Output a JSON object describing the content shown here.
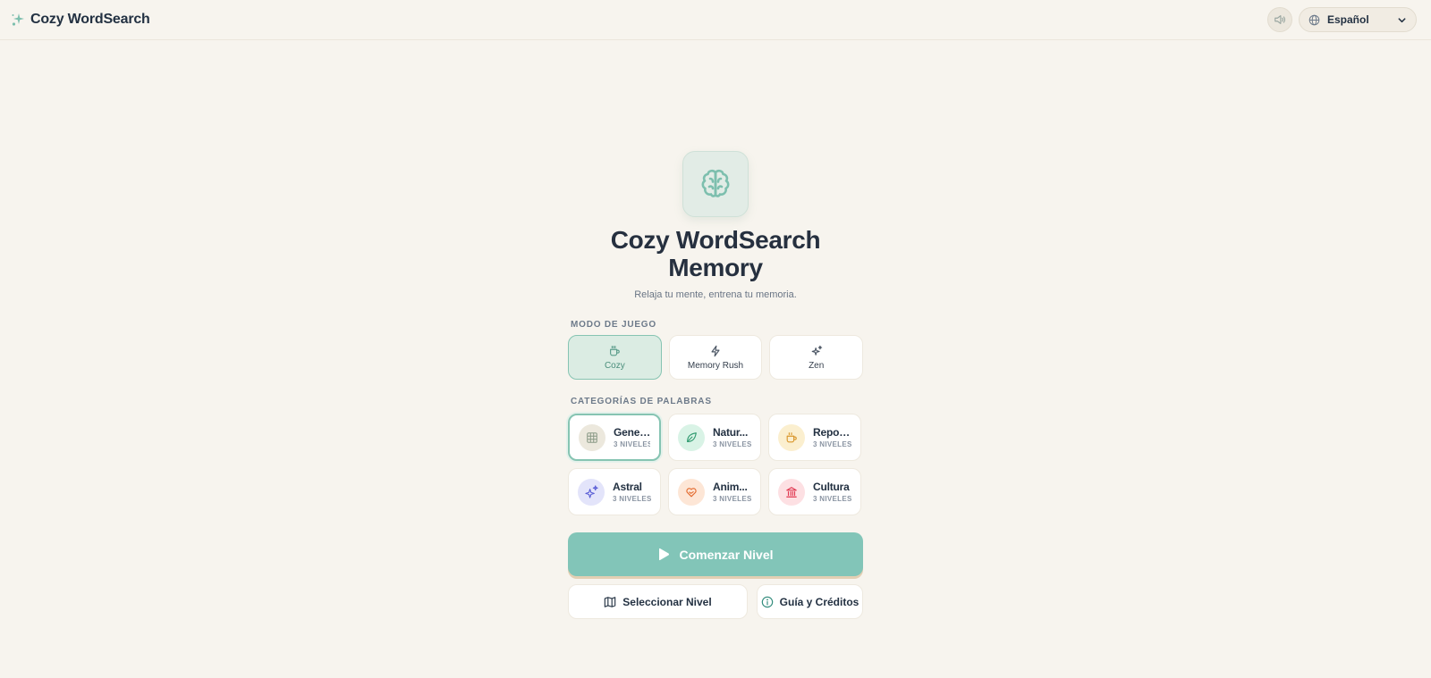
{
  "header": {
    "brand": "Cozy WordSearch",
    "language": "Español",
    "icons": {
      "brand": "sparkle-icon",
      "sound": "volume-icon",
      "language": "globe-icon",
      "chevron": "chevron-down-icon"
    }
  },
  "hero": {
    "icon": "brain-icon",
    "title_line1": "Cozy WordSearch",
    "title_line2": "Memory",
    "subtitle": "Relaja tu mente, entrena tu memoria."
  },
  "modes": {
    "label": "MODO DE JUEGO",
    "items": [
      {
        "label": "Cozy",
        "icon": "coffee-icon",
        "active": true
      },
      {
        "label": "Memory Rush",
        "icon": "zap-icon",
        "active": false
      },
      {
        "label": "Zen",
        "icon": "sparkles-icon",
        "active": false
      }
    ]
  },
  "categories": {
    "label": "CATEGORÍAS DE PALABRAS",
    "items": [
      {
        "name": "General",
        "levels": "3 NIVELES",
        "icon": "grid-icon",
        "color": "#8a9a86",
        "bg": "#ece8dd",
        "active": true
      },
      {
        "name": "Natur...",
        "levels": "3 NIVELES",
        "icon": "leaf-icon",
        "color": "#2f9a6f",
        "bg": "#d9f3e6",
        "active": false
      },
      {
        "name": "Repos...",
        "levels": "3 NIVELES",
        "icon": "cup-icon",
        "color": "#d9962b",
        "bg": "#fbefcf",
        "active": false
      },
      {
        "name": "Astral",
        "levels": "3 NIVELES",
        "icon": "stars-icon",
        "color": "#5b5fd6",
        "bg": "#e3e4fa",
        "active": false
      },
      {
        "name": "Anim...",
        "levels": "3 NIVELES",
        "icon": "heart-hand-icon",
        "color": "#e36a2e",
        "bg": "#fde6d6",
        "active": false
      },
      {
        "name": "Cultura",
        "levels": "3 NIVELES",
        "icon": "landmark-icon",
        "color": "#e0364f",
        "bg": "#fde0e3",
        "active": false
      }
    ]
  },
  "actions": {
    "start": "Comenzar Nivel",
    "select_level": "Seleccionar Nivel",
    "guide": "Guía y Créditos"
  },
  "colors": {
    "background": "#f7f4ee",
    "accent": "#82c5b8",
    "text": "#233142"
  }
}
